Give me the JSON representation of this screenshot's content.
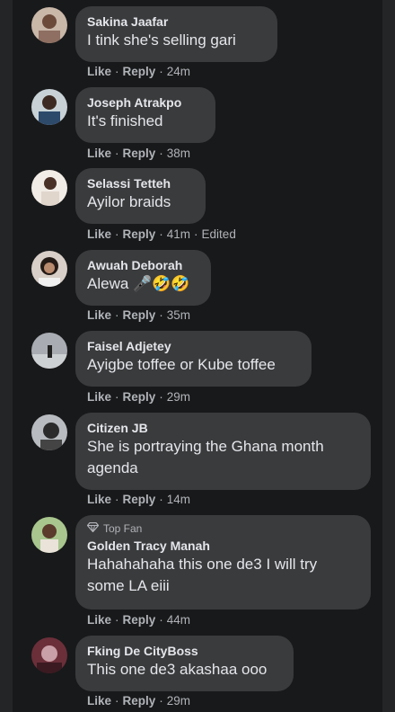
{
  "comments": [
    {
      "author": "Sakina Jaafar",
      "text": "I tink she's selling gari",
      "like": "Like",
      "reply": "Reply",
      "time": "24m"
    },
    {
      "author": "Joseph Atrakpo",
      "text": "It's finished",
      "like": "Like",
      "reply": "Reply",
      "time": "38m"
    },
    {
      "author": "Selassi Tetteh",
      "text": "Ayilor braids",
      "like": "Like",
      "reply": "Reply",
      "time": "41m",
      "edited": "Edited"
    },
    {
      "author": "Awuah Deborah",
      "text": "Alewa 🎤🤣🤣",
      "like": "Like",
      "reply": "Reply",
      "time": "35m"
    },
    {
      "author": "Faisel Adjetey",
      "text": "Ayigbe toffee or Kube toffee",
      "like": "Like",
      "reply": "Reply",
      "time": "29m"
    },
    {
      "author": "Citizen JB",
      "text_line1": "She is portraying the Ghana month",
      "text_line2": "agenda",
      "like": "Like",
      "reply": "Reply",
      "time": "14m"
    },
    {
      "badge": "Top Fan",
      "author": "Golden Tracy Manah",
      "text_line1": "Hahahahaha this one de3 I will try",
      "text_line2": "some LA eiii",
      "like": "Like",
      "reply": "Reply",
      "time": "44m"
    },
    {
      "author": "Fking De CityBoss",
      "text": "This one de3 akashaa ooo",
      "like": "Like",
      "reply": "Reply",
      "time": "29m"
    }
  ],
  "colors": {
    "background": "#18191a",
    "bubble": "#3a3b3c",
    "text": "#e4e6eb",
    "meta": "#b0b3b8"
  },
  "icons": {
    "badge": "diamond-icon"
  }
}
